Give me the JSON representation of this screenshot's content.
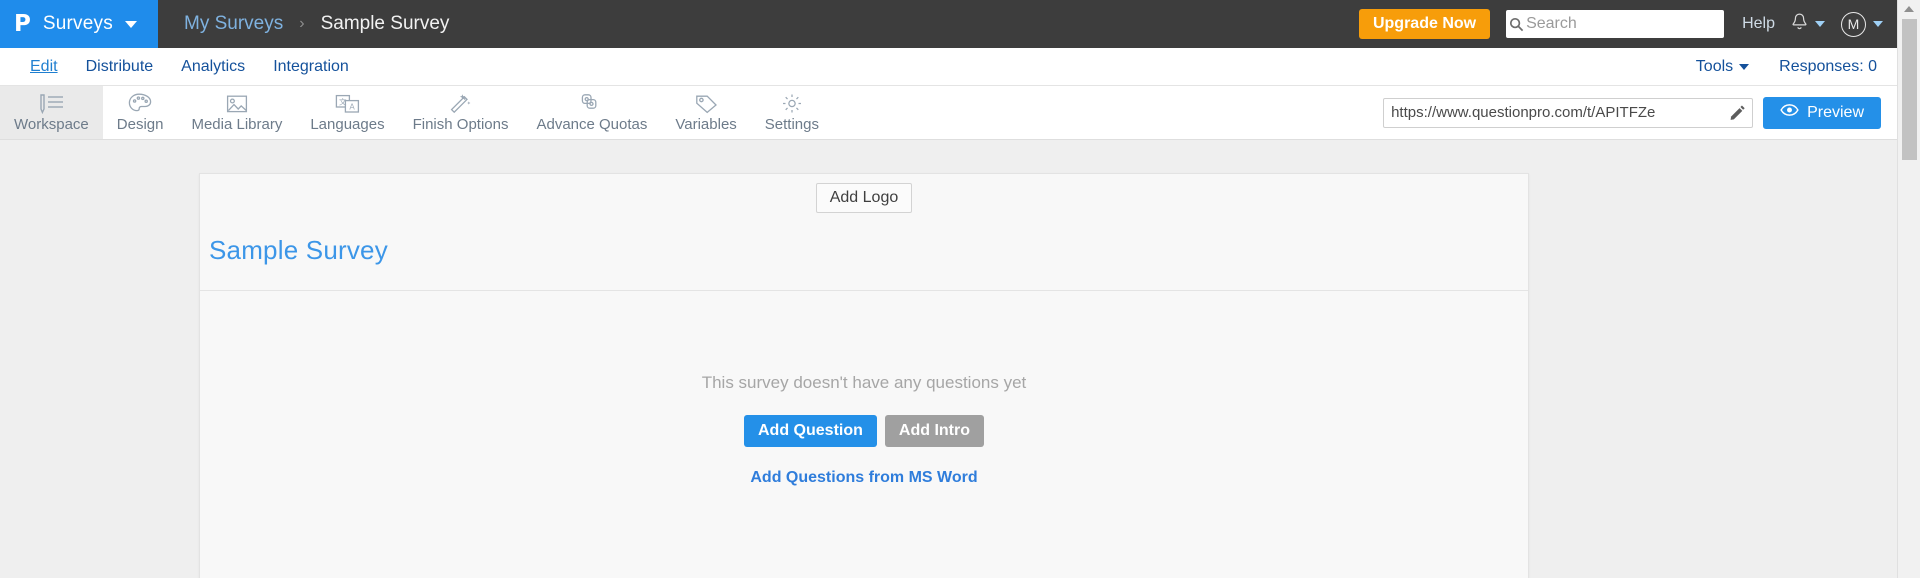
{
  "topbar": {
    "logo_glyph": "P",
    "logo_icon": "questionpro-logo-icon",
    "brand_label": "Surveys",
    "brand_caret_icon": "chevron-down-icon",
    "breadcrumb": {
      "parent": "My Surveys",
      "separator": "›",
      "current": "Sample Survey"
    },
    "upgrade_label": "Upgrade Now",
    "upgrade_color": "#f79d0a",
    "search": {
      "icon": "search-icon",
      "placeholder": "Search",
      "value": ""
    },
    "help_label": "Help",
    "bell_icon": "bell-icon",
    "bell_caret_icon": "chevron-down-icon",
    "avatar_initial": "M",
    "avatar_caret_icon": "chevron-down-icon"
  },
  "nav": {
    "items": [
      {
        "label": "Edit",
        "active": true
      },
      {
        "label": "Distribute",
        "active": false
      },
      {
        "label": "Analytics",
        "active": false
      },
      {
        "label": "Integration",
        "active": false
      }
    ],
    "tools_label": "Tools",
    "tools_caret_icon": "chevron-down-icon",
    "responses_label": "Responses: 0",
    "link_color": "#14519b"
  },
  "toolbar": {
    "items": [
      {
        "label": "Workspace",
        "icon": "workspace-list-icon",
        "active": true
      },
      {
        "label": "Design",
        "icon": "palette-icon",
        "active": false
      },
      {
        "label": "Media Library",
        "icon": "image-icon",
        "active": false
      },
      {
        "label": "Languages",
        "icon": "translate-icon",
        "active": false
      },
      {
        "label": "Finish Options",
        "icon": "magic-wand-icon",
        "active": false
      },
      {
        "label": "Advance Quotas",
        "icon": "links-icon",
        "active": false
      },
      {
        "label": "Variables",
        "icon": "tag-icon",
        "active": false
      },
      {
        "label": "Settings",
        "icon": "gear-icon",
        "active": false
      }
    ],
    "survey_url": "https://www.questionpro.com/t/APITFZe",
    "url_placeholder": "Survey URL",
    "edit_url_icon": "pencil-icon",
    "preview_label": "Preview",
    "preview_icon": "eye-icon",
    "preview_color": "#2490e8"
  },
  "survey": {
    "add_logo_label": "Add Logo",
    "title": "Sample Survey",
    "title_color": "#3c96e8",
    "empty_text": "This survey doesn't have any questions yet",
    "add_question_label": "Add Question",
    "add_intro_label": "Add Intro",
    "ms_word_link_label": "Add Questions from MS Word"
  },
  "scrollbar": {
    "up_arrow_icon": "scroll-up-arrow-icon",
    "thumb_icon": "scrollbar-thumb"
  }
}
